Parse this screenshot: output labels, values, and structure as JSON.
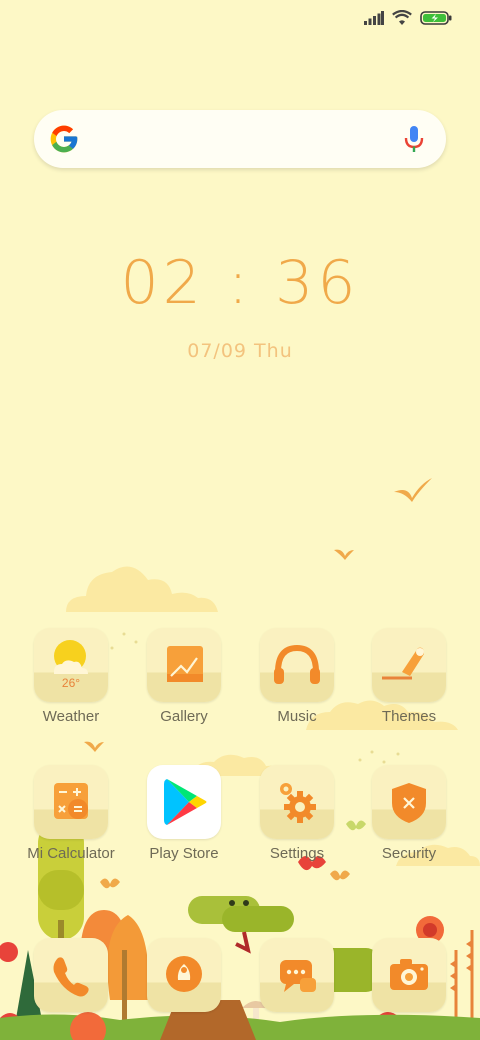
{
  "status": {
    "icons": [
      "signal-icon",
      "wifi-icon",
      "battery-charging-icon"
    ]
  },
  "search": {
    "logo": "google-logo",
    "mic": "mic-icon"
  },
  "clock": {
    "time": "02 : 36",
    "date": "07/09",
    "weekday": "Thu"
  },
  "weather": {
    "temp": "26°"
  },
  "apps_row1": [
    {
      "label": "Weather",
      "icon": "weather-icon"
    },
    {
      "label": "Gallery",
      "icon": "gallery-icon"
    },
    {
      "label": "Music",
      "icon": "headphones-icon"
    },
    {
      "label": "Themes",
      "icon": "brush-icon"
    }
  ],
  "apps_row2": [
    {
      "label": "Mi Calculator",
      "icon": "calculator-icon"
    },
    {
      "label": "Play Store",
      "icon": "play-store-icon"
    },
    {
      "label": "Settings",
      "icon": "gear-icon"
    },
    {
      "label": "Security",
      "icon": "shield-icon"
    }
  ],
  "dock": [
    {
      "icon": "phone-icon"
    },
    {
      "icon": "browser-icon"
    },
    {
      "icon": "messages-icon"
    },
    {
      "icon": "camera-icon"
    }
  ],
  "colors": {
    "background": "#fdf8c6",
    "accent": "#f0a94a",
    "tile": "#faf1c0"
  }
}
